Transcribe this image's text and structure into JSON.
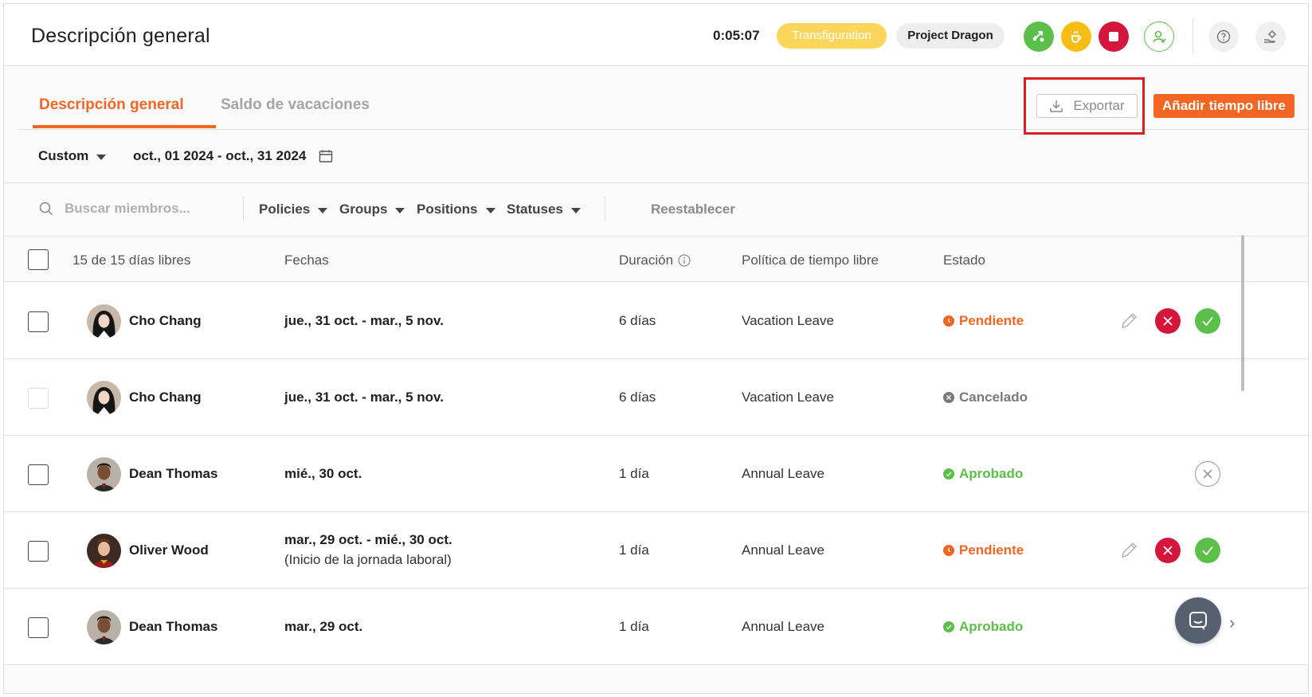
{
  "header": {
    "title": "Descripción general",
    "timer": "0:05:07",
    "project": "Transfiguration",
    "task": "Project Dragon",
    "icons": [
      "timer-switch-icon",
      "break-icon",
      "stop-icon",
      "user-status-icon",
      "help-icon",
      "settings-icon"
    ]
  },
  "tabs": {
    "overview": "Descripción general",
    "balance": "Saldo de vacaciones"
  },
  "actions": {
    "export": "Exportar",
    "add_time_off": "Añadir tiempo libre"
  },
  "date_filter": {
    "range_type": "Custom",
    "range": "oct., 01 2024 - oct., 31 2024"
  },
  "filters": {
    "search_placeholder": "Buscar miembros...",
    "policies": "Policies",
    "groups": "Groups",
    "positions": "Positions",
    "statuses": "Statuses",
    "reset": "Reestablecer"
  },
  "table": {
    "count_label": "15 de 15 días libres",
    "columns": {
      "dates": "Fechas",
      "duration": "Duración",
      "policy": "Política de tiempo libre",
      "status": "Estado"
    },
    "rows": [
      {
        "name": "Cho Chang",
        "dates": "jue., 31 oct. - mar., 5 nov.",
        "dates_sub": "",
        "duration": "6 días",
        "policy": "Vacation Leave",
        "status": "Pendiente"
      },
      {
        "name": "Cho Chang",
        "dates": "jue., 31 oct. - mar., 5 nov.",
        "dates_sub": "",
        "duration": "6 días",
        "policy": "Vacation Leave",
        "status": "Cancelado"
      },
      {
        "name": "Dean Thomas",
        "dates": "mié., 30 oct.",
        "dates_sub": "",
        "duration": "1 día",
        "policy": "Annual Leave",
        "status": "Aprobado"
      },
      {
        "name": "Oliver Wood",
        "dates": "mar., 29 oct. - mié., 30 oct.",
        "dates_sub": "(Inicio de la jornada laboral)",
        "duration": "1 día",
        "policy": "Annual Leave",
        "status": "Pendiente"
      },
      {
        "name": "Dean Thomas",
        "dates": "mar., 29 oct.",
        "dates_sub": "",
        "duration": "1 día",
        "policy": "Annual Leave",
        "status": "Aprobado"
      }
    ]
  },
  "colors": {
    "accent": "#f26522",
    "pending": "#f26522",
    "approved": "#5cbf4a",
    "cancelled": "#7a7a7a",
    "reject": "#d4163c",
    "highlight": "#d81e1e"
  }
}
